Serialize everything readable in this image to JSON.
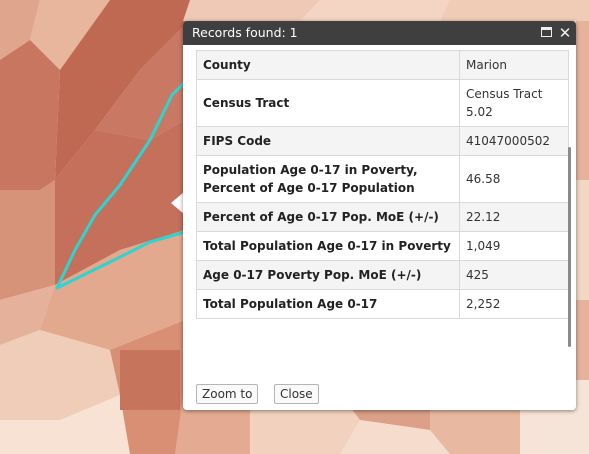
{
  "map": {
    "highlight_color": "#2fd3cf",
    "fill_colors": [
      "#c36a54",
      "#d98f75",
      "#e8b49c",
      "#f2cfb9",
      "#f9e6d8"
    ]
  },
  "popup": {
    "title": "Records found: 1",
    "maximize_icon": "maximize-icon",
    "close_icon": "close-icon",
    "close_glyph": "✕",
    "rows": [
      {
        "label": "County",
        "value": "Marion"
      },
      {
        "label": "Census Tract",
        "value": "Census Tract 5.02"
      },
      {
        "label": "FIPS Code",
        "value": "41047000502"
      },
      {
        "label": "Population Age 0-17 in Poverty, Percent of Age 0-17 Population",
        "value": "46.58"
      },
      {
        "label": "Percent of Age 0-17 Pop. MoE (+/-)",
        "value": "22.12"
      },
      {
        "label": "Total Population Age 0-17 in Poverty",
        "value": "1,049"
      },
      {
        "label": "Age 0-17 Poverty Pop. MoE (+/-)",
        "value": "425"
      },
      {
        "label": "Total Population Age 0-17",
        "value": "2,252"
      }
    ],
    "actions": {
      "zoom_label": "Zoom to",
      "close_label": "Close"
    }
  }
}
